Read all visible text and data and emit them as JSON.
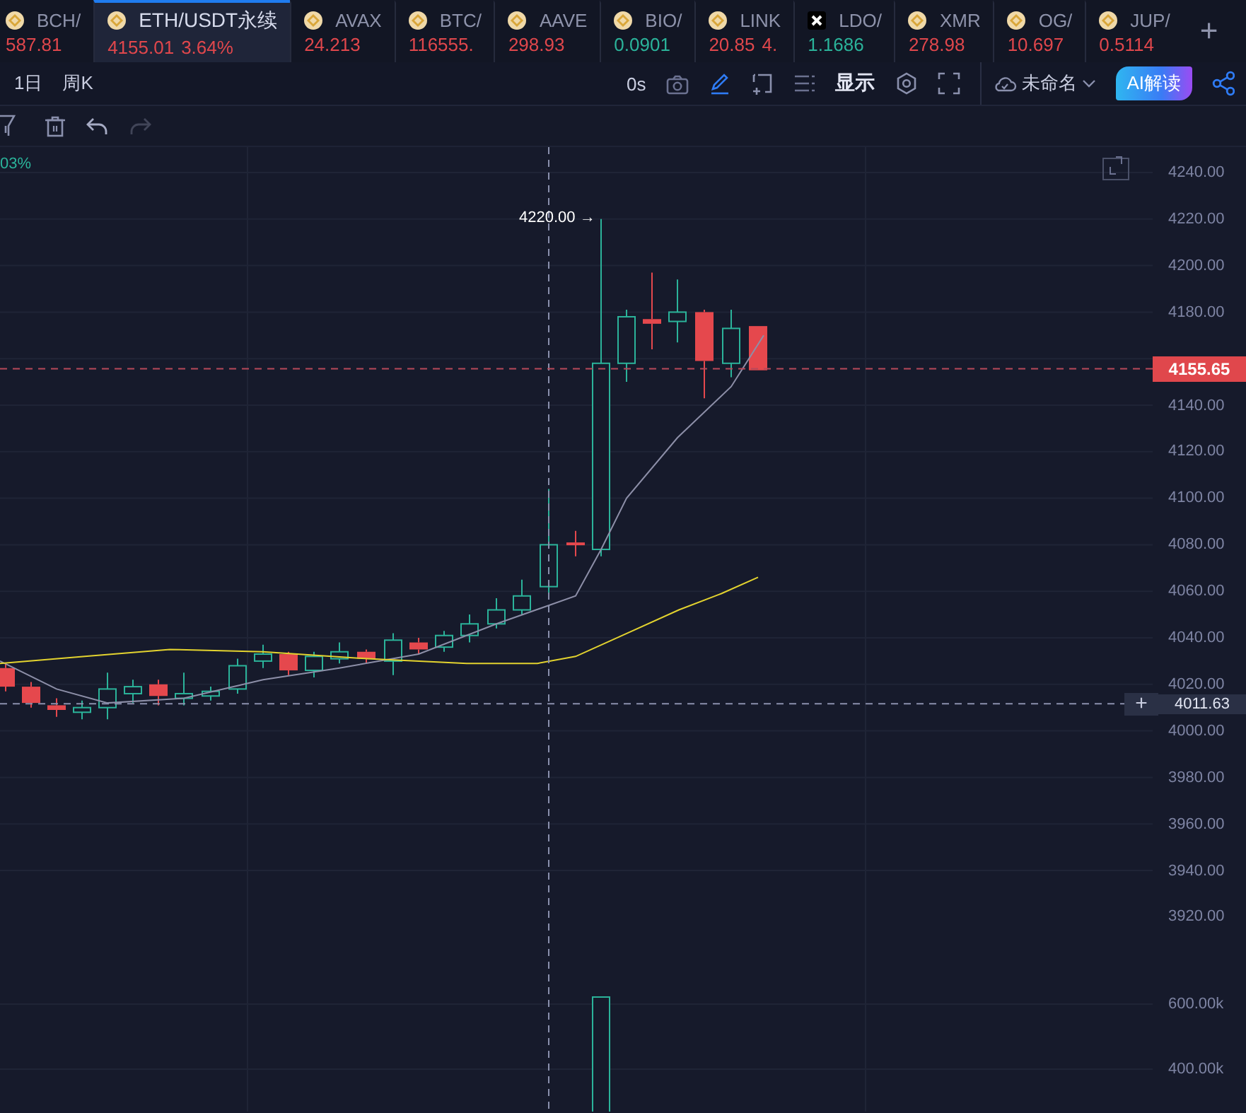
{
  "tickers": [
    {
      "kind": "coin",
      "symbol": "BCH/",
      "price": "587.81",
      "color": "#e0474c",
      "selected": false
    },
    {
      "kind": "coin",
      "symbol": "ETH/USDT永续",
      "price": "4155.01",
      "change": "3.64%",
      "color": "#e0474c",
      "selected": true
    },
    {
      "kind": "coin",
      "symbol": "AVAX",
      "price": "24.213",
      "color": "#e0474c",
      "selected": false
    },
    {
      "kind": "coin",
      "symbol": "BTC/",
      "price": "116555.",
      "color": "#e0474c",
      "selected": false
    },
    {
      "kind": "coin",
      "symbol": "AAVE",
      "price": "298.93",
      "color": "#e0474c",
      "selected": false
    },
    {
      "kind": "coin",
      "symbol": "BIO/",
      "price": "0.0901",
      "color": "#2bb39a",
      "selected": false
    },
    {
      "kind": "coin",
      "symbol": "LINK",
      "price": "20.85",
      "change": "4.",
      "color": "#e0474c",
      "selected": false
    },
    {
      "kind": "cross",
      "symbol": "LDO/",
      "price": "1.1686",
      "color": "#2bb39a",
      "selected": false
    },
    {
      "kind": "coin",
      "symbol": "XMR",
      "price": "278.98",
      "color": "#e0474c",
      "selected": false
    },
    {
      "kind": "coin",
      "symbol": "OG/",
      "price": "10.697",
      "color": "#e0474c",
      "selected": false
    },
    {
      "kind": "coin",
      "symbol": "JUP/",
      "price": "0.5114",
      "color": "#e0474c",
      "selected": false
    }
  ],
  "add_tab": "+",
  "toolbar": {
    "intervals": [
      "1日",
      "周K"
    ],
    "timer": "0s",
    "display_label": "显示",
    "layout_name": "未命名",
    "ai_button": "AI解读"
  },
  "drawing_bar": {
    "redo_disabled": true
  },
  "chart": {
    "indicator_value": "03%",
    "high_label": "4220.00 →",
    "price_axis": [
      "4240.00",
      "4220.00",
      "4200.00",
      "4180.00",
      "4140.00",
      "4120.00",
      "4100.00",
      "4080.00",
      "4060.00",
      "4040.00",
      "4020.00",
      "4000.00",
      "3980.00",
      "3960.00",
      "3940.00",
      "3920.00"
    ],
    "last_price": "4155.65",
    "crosshair_price": "4011.63",
    "crosshair_button": "+",
    "volume_axis": [
      "600.00k",
      "400.00k"
    ]
  }
}
